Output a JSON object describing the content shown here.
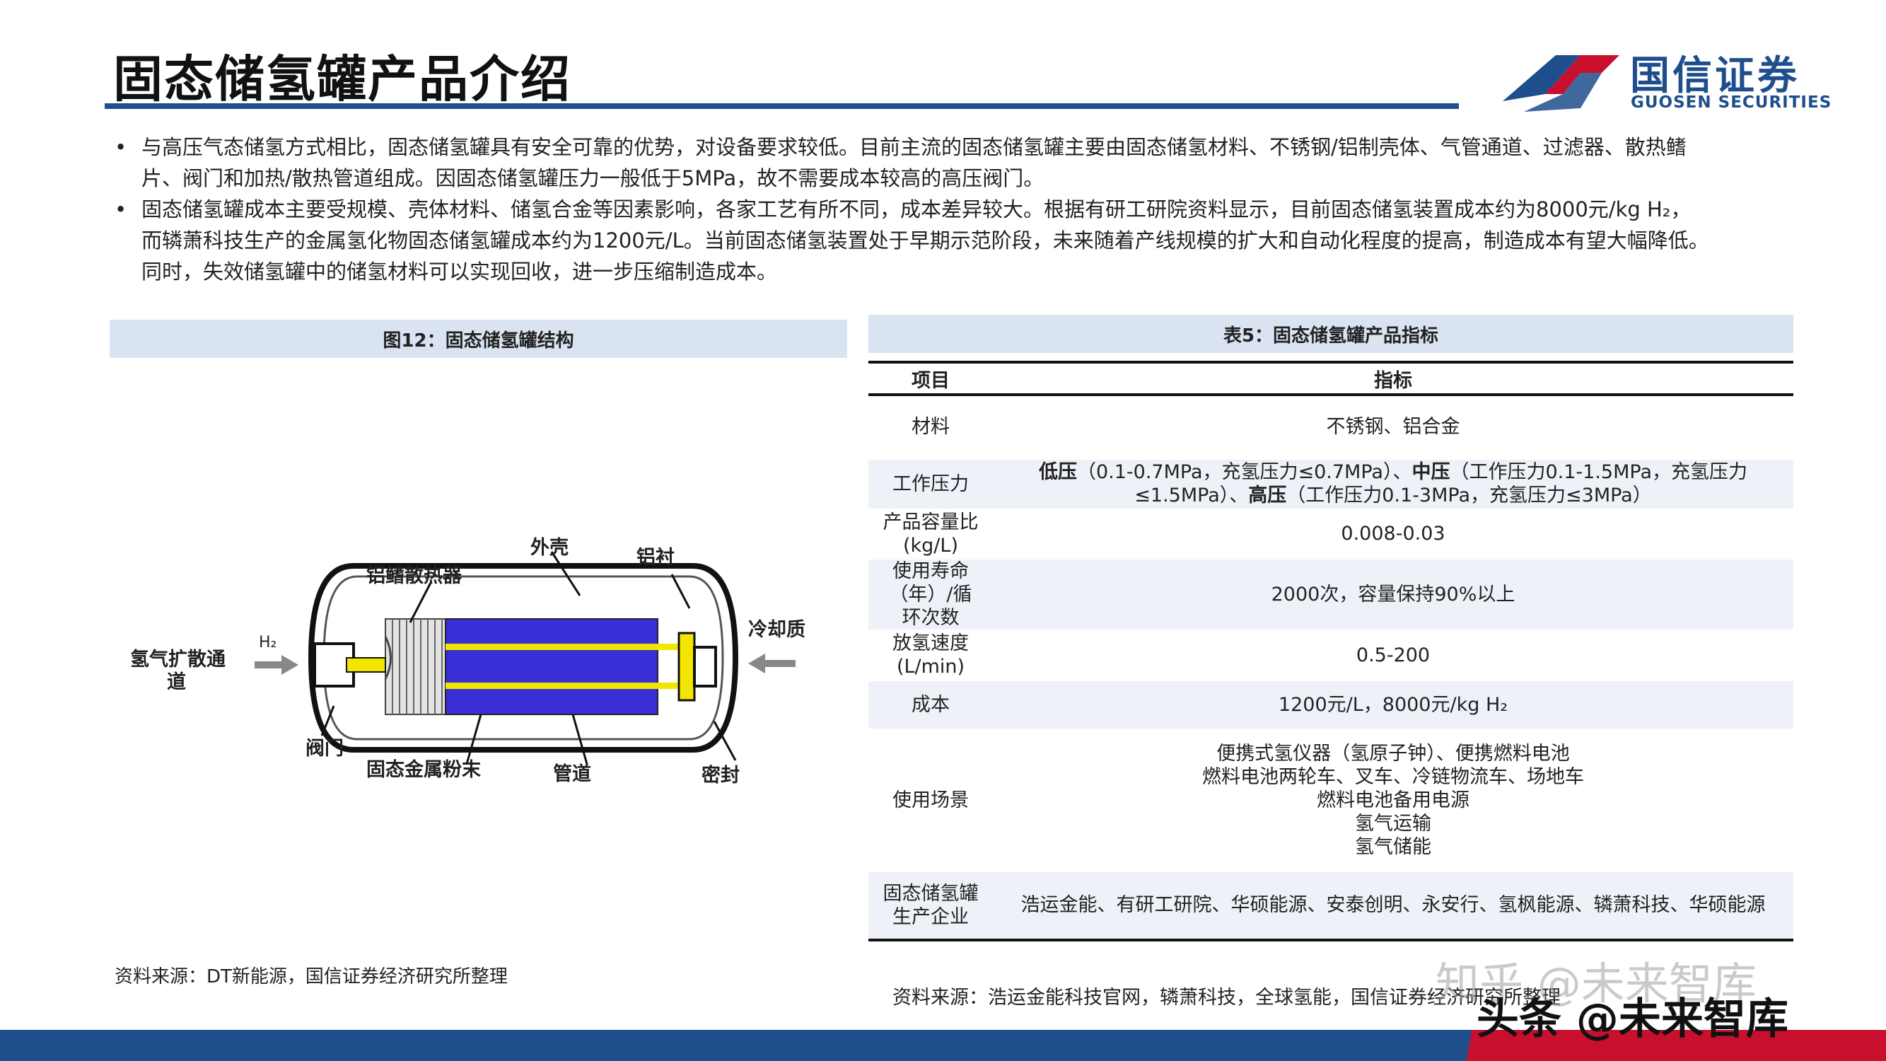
{
  "header": {
    "title": "固态储氢罐产品介绍",
    "logo_cn": "国信证券",
    "logo_en": "GUOSEN SECURITIES"
  },
  "bullets": [
    {
      "lines": [
        "与高压气态储氢方式相比，固态储氢罐具有安全可靠的优势，对设备要求较低。目前主流的固态储氢罐主要由固态储氢材料、不锈钢/铝制壳体、气管通道、过滤器、散热鳍",
        "片、阀门和加热/散热管道组成。因固态储氢罐压力一般低于5MPa，故不需要成本较高的高压阀门。"
      ]
    },
    {
      "lines": [
        "固态储氢罐成本主要受规模、壳体材料、储氢合金等因素影响，各家工艺有所不同，成本差异较大。根据有研工研院资料显示，目前固态储氢装置成本约为8000元/kg H₂，",
        "而辚萧科技生产的金属氢化物固态储氢罐成本约为1200元/L。当前固态储氢装置处于早期示范阶段，未来随着产线规模的扩大和自动化程度的提高，制造成本有望大幅降低。",
        "同时，失效储氢罐中的储氢材料可以实现回收，进一步压缩制造成本。"
      ]
    }
  ],
  "figure": {
    "caption": "图12：固态储氢罐结构",
    "labels": {
      "shell": "外壳",
      "liner": "铝衬",
      "fins": "铝鳍散热器",
      "coolant": "冷却质",
      "diffusion": "氢气扩散通",
      "diffusion2": "道",
      "h2": "H₂",
      "valve": "阀门",
      "powder": "固态金属粉末",
      "pipe": "管道",
      "seal": "密封"
    },
    "colors": {
      "powder": "#3a2fd6",
      "pipe": "#f2e600",
      "shell": "#111111",
      "fins": "#d9d9d9"
    },
    "source": "资料来源：DT新能源，国信证券经济研究所整理"
  },
  "table": {
    "caption": "表5：固态储氢罐产品指标",
    "headers": [
      "项目",
      "指标"
    ],
    "rows": [
      {
        "item": [
          "材料"
        ],
        "value": [
          "不锈钢、铝合金"
        ]
      },
      {
        "item": [
          "工作压力"
        ],
        "value_rich": true
      },
      {
        "item": [
          "产品容量比",
          "(kg/L)"
        ],
        "value": [
          "0.008-0.03"
        ]
      },
      {
        "item": [
          "使用寿命",
          "（年）/循",
          "环次数"
        ],
        "value": [
          "2000次，容量保持90%以上"
        ]
      },
      {
        "item": [
          "放氢速度",
          "(L/min)"
        ],
        "value": [
          "0.5-200"
        ]
      },
      {
        "item": [
          "成本"
        ],
        "value": [
          "1200元/L，8000元/kg H₂"
        ]
      },
      {
        "item": [
          "使用场景"
        ],
        "value": [
          "便携式氢仪器（氢原子钟）、便携燃料电池",
          "燃料电池两轮车、叉车、冷链物流车、场地车",
          "燃料电池备用电源",
          "氢气运输",
          "氢气储能"
        ]
      },
      {
        "item": [
          "固态储氢罐",
          "生产企业"
        ],
        "value": [
          "浩运金能、有研工研院、华硕能源、安泰创明、永安行、氢枫能源、辚萧科技、华硕能源"
        ]
      }
    ],
    "pressure": {
      "low_label": "低压",
      "low_text": "（0.1-0.7MPa，充氢压力≤0.7MPa）、",
      "mid_label": "中压",
      "mid_text": "（工作压力0.1-1.5MPa，充氢压力",
      "mid_text2": "≤1.5MPa）、",
      "high_label": "高压",
      "high_text": "（工作压力0.1-3MPa，充氢压力≤3MPa）"
    },
    "source": "资料来源：浩运金能科技官网，辚萧科技，全球氢能，国信证券经济研究所整理"
  },
  "watermarks": {
    "line1": "知乎 @未来智库",
    "line2": "头条 @未来智库"
  }
}
